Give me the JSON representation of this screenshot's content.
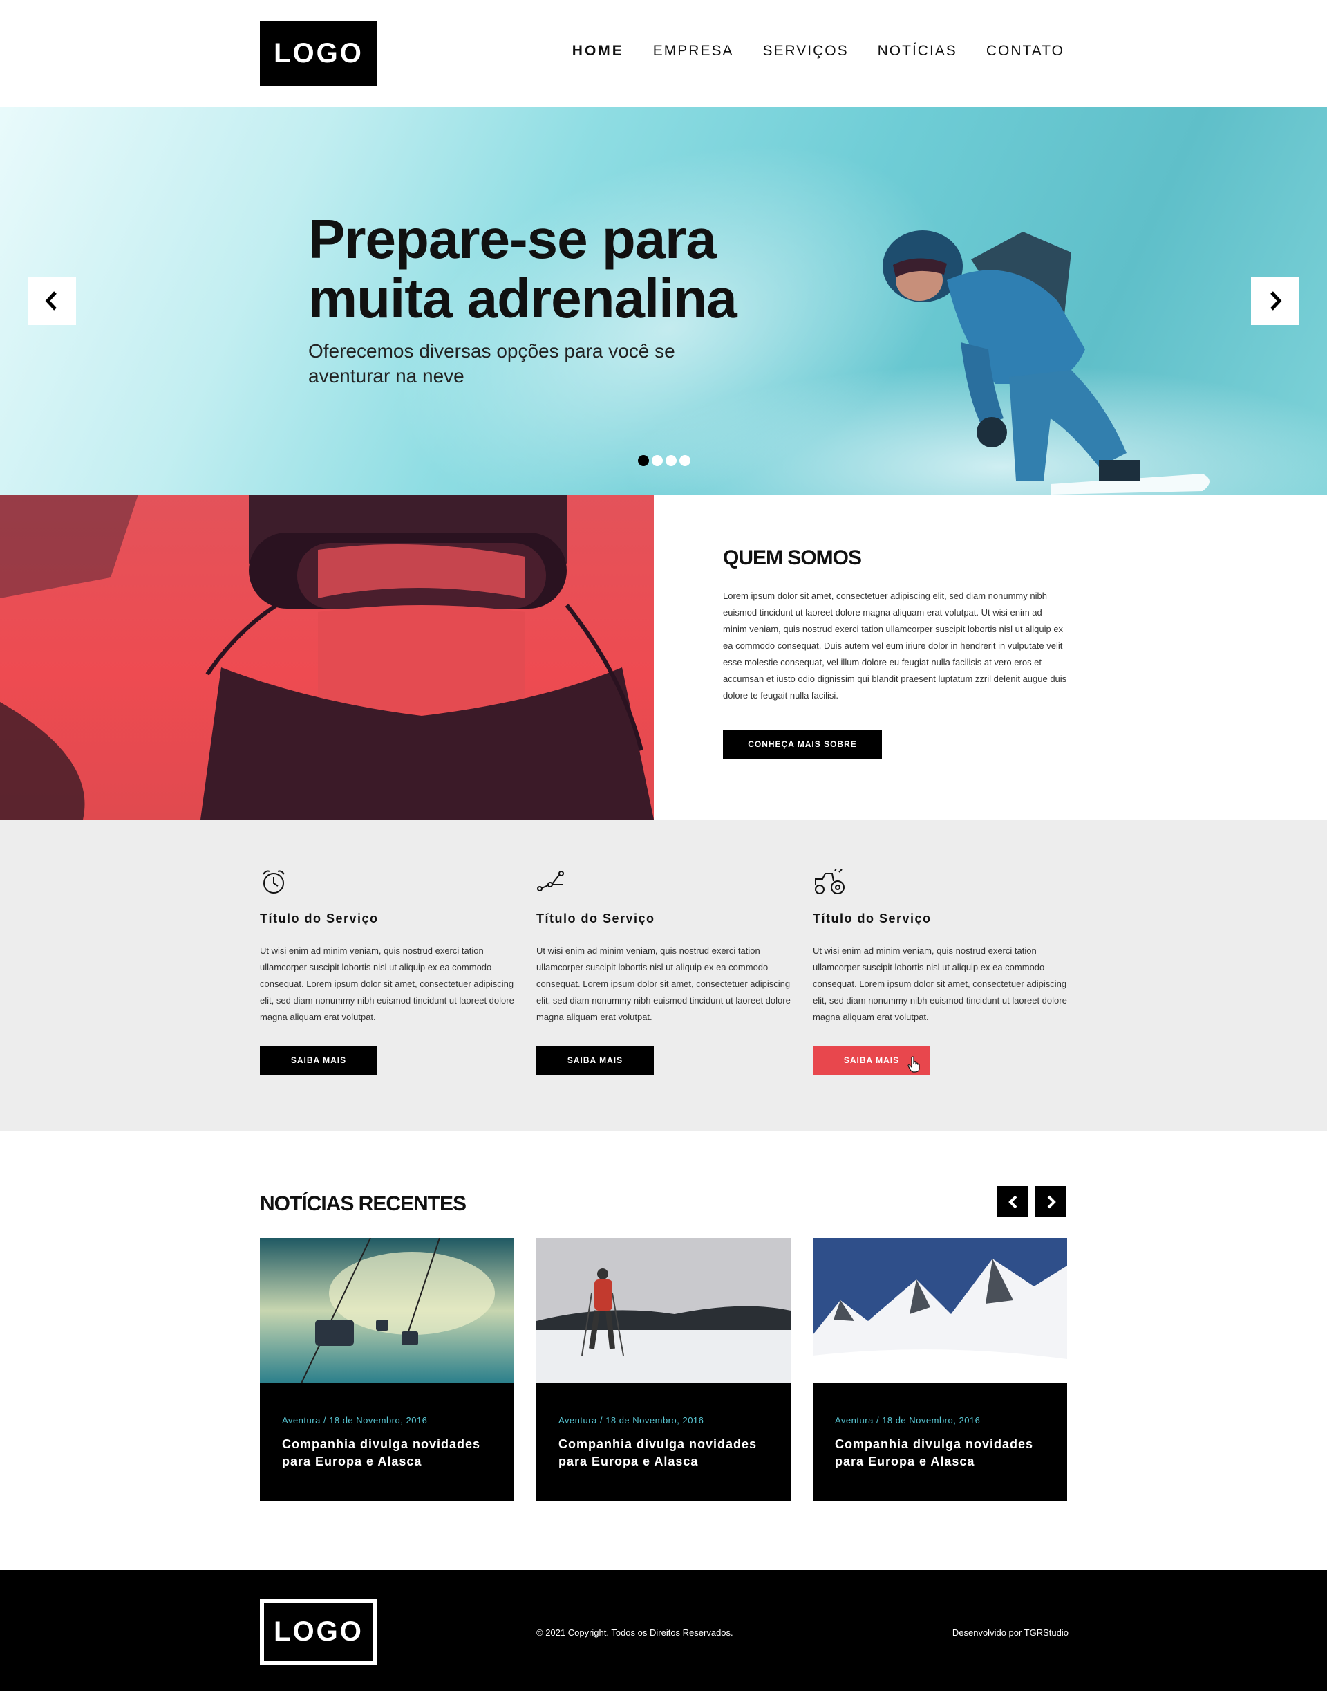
{
  "header": {
    "logo": "LOGO",
    "nav": [
      "HOME",
      "EMPRESA",
      "SERVIÇOS",
      "NOTÍCIAS",
      "CONTATO"
    ]
  },
  "hero": {
    "title": "Prepare-se para muita adrenalina",
    "subtitle": "Oferecemos diversas opções para você se aventurar na neve",
    "slide_count": 4,
    "active_slide": 1,
    "colors": {
      "bg": "#7fd3d9"
    }
  },
  "about": {
    "title": "QUEM SOMOS",
    "body": "Lorem ipsum dolor sit amet, consectetuer adipiscing elit, sed diam nonummy nibh euismod tincidunt ut laoreet dolore magna aliquam erat volutpat. Ut wisi enim ad minim veniam, quis nostrud exerci tation ullamcorper suscipit lobortis nisl ut aliquip ex ea commodo consequat. Duis autem vel eum iriure dolor in hendrerit in vulputate velit esse molestie consequat, vel illum dolore eu feugiat nulla facilisis at vero eros et accumsan et iusto odio dignissim qui blandit praesent luptatum zzril delenit augue duis dolore te feugait nulla facilisi.",
    "button": "CONHEÇA MAIS SOBRE",
    "colors": {
      "photo_tint": "#ee4b51"
    }
  },
  "services": {
    "items": [
      {
        "icon": "alarm-clock-icon",
        "title": "Título do Serviço",
        "body": "Ut wisi enim ad minim veniam, quis nostrud exerci tation ullamcorper suscipit lobortis nisl ut aliquip ex ea commodo consequat. Lorem ipsum dolor sit amet, consectetuer adipiscing elit, sed diam nonummy nibh euismod tincidunt ut laoreet dolore magna aliquam erat volutpat.",
        "button": "SAIBA MAIS"
      },
      {
        "icon": "node-path-icon",
        "title": "Título do Serviço",
        "body": "Ut wisi enim ad minim veniam, quis nostrud exerci tation ullamcorper suscipit lobortis nisl ut aliquip ex ea commodo consequat. Lorem ipsum dolor sit amet, consectetuer adipiscing elit, sed diam nonummy nibh euismod tincidunt ut laoreet dolore magna aliquam erat volutpat.",
        "button": "SAIBA MAIS"
      },
      {
        "icon": "tractor-icon",
        "title": "Título do Serviço",
        "body": "Ut wisi enim ad minim veniam, quis nostrud exerci tation ullamcorper suscipit lobortis nisl ut aliquip ex ea commodo consequat. Lorem ipsum dolor sit amet, consectetuer adipiscing elit, sed diam nonummy nibh euismod tincidunt ut laoreet dolore magna aliquam erat volutpat.",
        "button": "SAIBA MAIS"
      }
    ],
    "colors": {
      "bg": "#ededed",
      "highlight_button": "#e8474d"
    }
  },
  "news": {
    "title": "NOTÍCIAS RECENTES",
    "cards": [
      {
        "meta": "Aventura / 18 de Novembro, 2016",
        "headline": "Companhia divulga novidades para Europa e Alasca"
      },
      {
        "meta": "Aventura / 18 de Novembro, 2016",
        "headline": "Companhia divulga novidades para Europa e Alasca"
      },
      {
        "meta": "Aventura / 18 de Novembro, 2016",
        "headline": "Companhia divulga novidades para Europa e Alasca"
      }
    ],
    "colors": {
      "meta": "#59c7d4"
    }
  },
  "footer": {
    "logo": "LOGO",
    "copyright": "© 2021 Copyright. Todos os Direitos Reservados.",
    "developer": "Desenvolvido por TGRStudio"
  }
}
